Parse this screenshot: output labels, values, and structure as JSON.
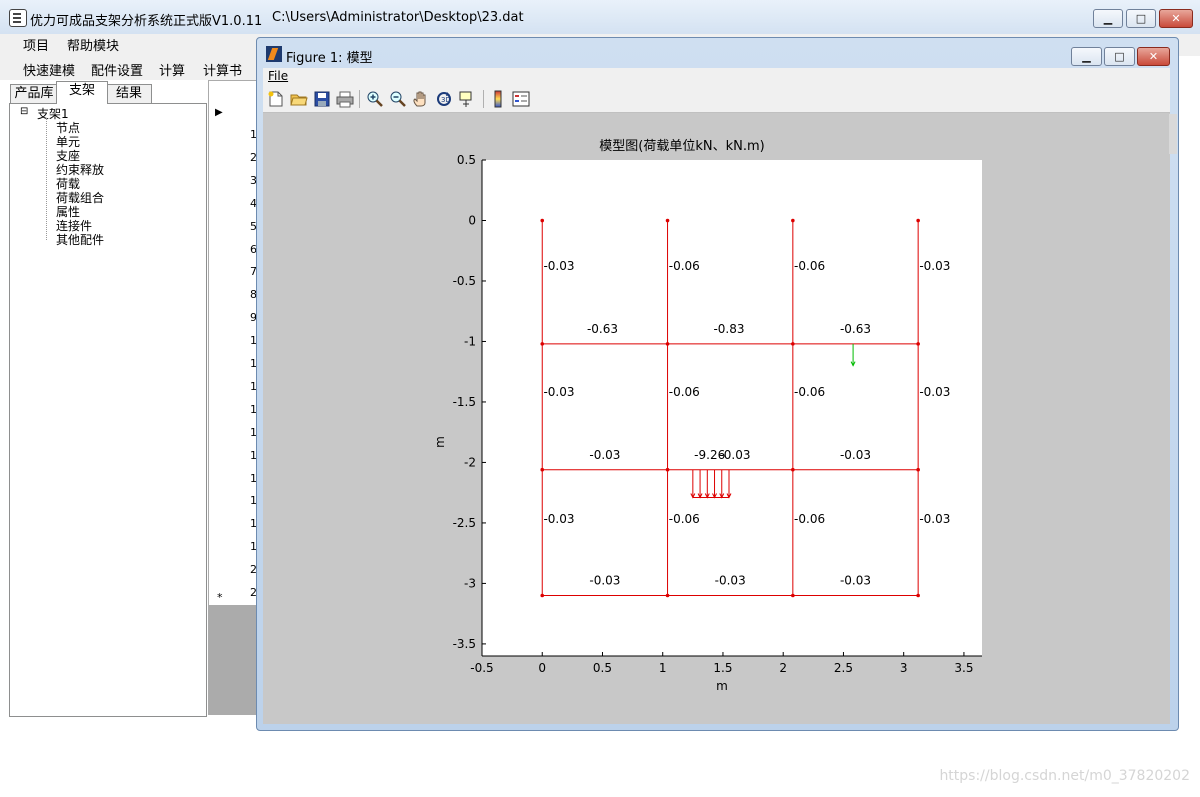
{
  "main_window": {
    "app_title": "优力可成品支架分析系统正式版V1.0.11",
    "file_path": "C:\\Users\\Administrator\\Desktop\\23.dat"
  },
  "menu": {
    "items": [
      "项目",
      "帮助模块"
    ]
  },
  "toolbar": {
    "items": [
      "快速建模",
      "配件设置",
      "计算",
      "计算书"
    ]
  },
  "left_tabs": {
    "items": [
      "产品库",
      "支架",
      "结果"
    ],
    "active": "支架"
  },
  "tree": {
    "root": "支架1",
    "toggle": "⊟",
    "children": [
      "节点",
      "单元",
      "支座",
      "约束释放",
      "荷载",
      "荷载组合",
      "属性",
      "连接件",
      "其他配件"
    ]
  },
  "grid": {
    "row_numbers": [
      "1",
      "2",
      "3",
      "4",
      "5",
      "6",
      "7",
      "8",
      "9",
      "1",
      "1",
      "1",
      "1",
      "1",
      "1",
      "1",
      "1",
      "1",
      "1",
      "2",
      "2"
    ],
    "new_row_marker": "*",
    "current_row_marker": "▶"
  },
  "figure_window": {
    "title": "Figure 1: 模型",
    "menu_file": "File",
    "toolbar_icons": [
      "new-file-icon",
      "open-folder-icon",
      "save-icon",
      "print-icon",
      "zoom-in-icon",
      "zoom-out-icon",
      "pan-hand-icon",
      "rotate-icon",
      "data-cursor-icon",
      "colorbar-icon",
      "legend-icon"
    ]
  },
  "chart_data": {
    "type": "structural-frame",
    "title": "模型图(荷载单位kN、kN.m)",
    "xlabel": "m",
    "ylabel": "m",
    "xlim": [
      -0.5,
      3.65
    ],
    "ylim": [
      -3.6,
      0.5
    ],
    "xticks": [
      -0.5,
      0,
      0.5,
      1,
      1.5,
      2,
      2.5,
      3,
      3.5
    ],
    "xtick_labels": [
      "-0.5",
      "0",
      "0.5",
      "1",
      "1.5",
      "2",
      "2.5",
      "3",
      "3.5"
    ],
    "yticks": [
      0.5,
      0,
      -0.5,
      -1,
      -1.5,
      -2,
      -2.5,
      -3,
      -3.5
    ],
    "ytick_labels": [
      "0.5",
      "0",
      "-0.5",
      "-1",
      "-1.5",
      "-2",
      "-2.5",
      "-3",
      "-3.5"
    ],
    "frame_color": "#dd0000",
    "load_color": "#00bb00",
    "columns_x": [
      0,
      1.04,
      2.08,
      3.12
    ],
    "beams_y": [
      -1.02,
      -2.06,
      -3.1
    ],
    "top_y": 0,
    "member_labels": [
      {
        "x": 0.01,
        "y": -0.41,
        "text": "-0.03"
      },
      {
        "x": 1.05,
        "y": -0.41,
        "text": "-0.06"
      },
      {
        "x": 2.09,
        "y": -0.41,
        "text": "-0.06"
      },
      {
        "x": 3.13,
        "y": -0.41,
        "text": "-0.03"
      },
      {
        "x": 0.5,
        "y": -0.93,
        "text": "-0.63"
      },
      {
        "x": 1.55,
        "y": -0.93,
        "text": "-0.83"
      },
      {
        "x": 2.6,
        "y": -0.93,
        "text": "-0.63"
      },
      {
        "x": 0.01,
        "y": -1.45,
        "text": "-0.03"
      },
      {
        "x": 1.05,
        "y": -1.45,
        "text": "-0.06"
      },
      {
        "x": 2.09,
        "y": -1.45,
        "text": "-0.06"
      },
      {
        "x": 3.13,
        "y": -1.45,
        "text": "-0.03"
      },
      {
        "x": 0.52,
        "y": -1.97,
        "text": "-0.03"
      },
      {
        "x": 1.39,
        "y": -1.97,
        "text": "-9.26"
      },
      {
        "x": 1.6,
        "y": -1.97,
        "text": "-0.03"
      },
      {
        "x": 2.6,
        "y": -1.97,
        "text": "-0.03"
      },
      {
        "x": 0.01,
        "y": -2.5,
        "text": "-0.03"
      },
      {
        "x": 1.05,
        "y": -2.5,
        "text": "-0.06"
      },
      {
        "x": 2.09,
        "y": -2.5,
        "text": "-0.06"
      },
      {
        "x": 3.13,
        "y": -2.5,
        "text": "-0.03"
      },
      {
        "x": 0.52,
        "y": -3.01,
        "text": "-0.03"
      },
      {
        "x": 1.56,
        "y": -3.01,
        "text": "-0.03"
      },
      {
        "x": 2.6,
        "y": -3.01,
        "text": "-0.03"
      }
    ],
    "distributed_load": {
      "x_start": 1.25,
      "x_end": 1.55,
      "y_top": -2.06,
      "y_bottom": -2.29,
      "count": 6
    },
    "point_load": {
      "x": 2.58,
      "y_top": -1.02,
      "y_bottom": -1.2
    }
  }
}
